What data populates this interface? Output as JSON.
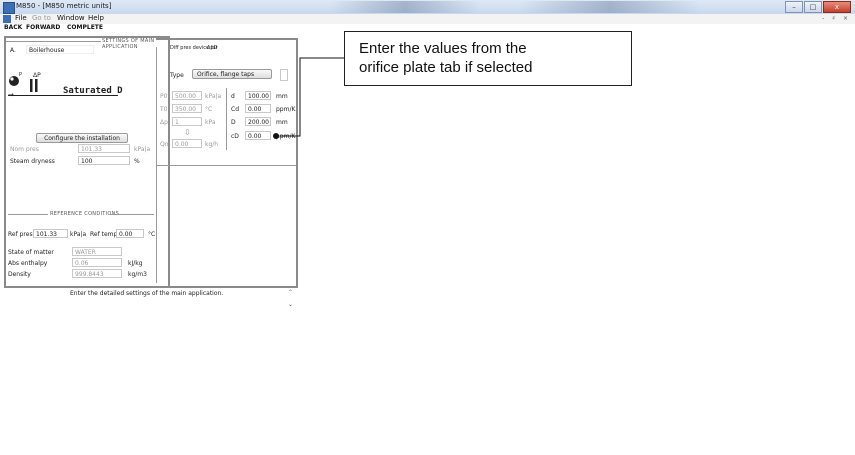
{
  "window": {
    "title": "M850 - [M850 metric units]",
    "controls": {
      "minimize": "–",
      "maximize": "□",
      "close": "x"
    }
  },
  "menu": {
    "file": "File",
    "goto": "Go to",
    "window": "Window",
    "help": "Help"
  },
  "mdi_controls": "- ♯ ×",
  "nav": {
    "back": "BACK",
    "forward": "FORWARD",
    "complete": "COMPLETE"
  },
  "settings": {
    "group_title": "SETTINGS OF MAIN APPLICATION",
    "id_prefix": "A.",
    "app_name": "Boilerhouse",
    "symbol_p": "P",
    "symbol_dp": "ΔP",
    "state_label": "Saturated D",
    "configure_button": "Configure the installation",
    "nom_pres_label": "Nom pres",
    "nom_pres_value": "101.33",
    "nom_pres_unit": "kPa|a",
    "steam_dryness_label": "Steam dryness",
    "steam_dryness_value": "100",
    "steam_dryness_unit": "%",
    "diff_device_label": "Diff pres device for",
    "diff_device_symbol": "ΔpD",
    "type_label": "Type",
    "type_value": "Orifice, flange taps",
    "p0_label": "P0",
    "p0_value": "500.00",
    "p0_unit": "kPa|a",
    "t0_label": "T0",
    "t0_value": "350.00",
    "t0_unit": "°C",
    "dp_label": "Δp",
    "dp_value": "1",
    "dp_unit": "kPa",
    "qm_label": "Qm",
    "qm_value": "0.00",
    "qm_unit": "kg/h",
    "d_label": "d",
    "d_value": "100.00",
    "d_unit": "mm",
    "cd_label": "Cd",
    "cd_value": "0.00",
    "cd_unit": "ppm/K",
    "D_label": "D",
    "D_value": "200.00",
    "D_unit": "mm",
    "cD_label": "cD",
    "cD_value": "0.00",
    "cD_unit": "ppm/K"
  },
  "reference": {
    "group_title": "REFERENCE CONDITIONS",
    "ref_pres_label": "Ref pres",
    "ref_pres_value": "101.33",
    "ref_pres_unit": "kPa|a",
    "ref_temp_label": "Ref temp",
    "ref_temp_value": "0.00",
    "ref_temp_unit": "°C",
    "state_label": "State of matter",
    "state_value": "WATER",
    "enthalpy_label": "Abs enthalpy",
    "enthalpy_value": "0.06",
    "enthalpy_unit": "kJ/kg",
    "density_label": "Density",
    "density_value": "999.8443",
    "density_unit": "kg/m3"
  },
  "status_message": "Enter the detailed settings of the main application.",
  "callout": {
    "line1": "Enter the values from the",
    "line2": "orifice plate tab if selected"
  }
}
